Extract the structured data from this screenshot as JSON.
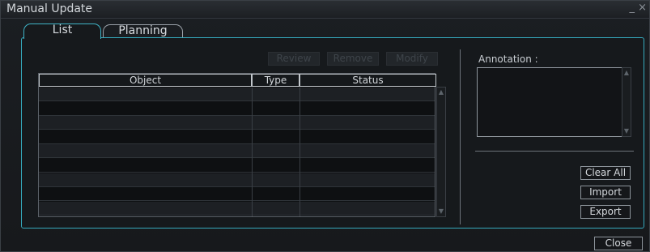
{
  "window": {
    "title": "Manual Update",
    "controls": "_ ×"
  },
  "tabs": [
    {
      "label": "List",
      "active": true
    },
    {
      "label": "Planning",
      "active": false
    }
  ],
  "toolbar": {
    "review_label": "Review",
    "remove_label": "Remove",
    "modify_label": "Modify"
  },
  "table": {
    "columns": [
      "Object",
      "Type",
      "Status"
    ],
    "rows": [
      {
        "object": "",
        "type": "",
        "status": ""
      },
      {
        "object": "",
        "type": "",
        "status": ""
      },
      {
        "object": "",
        "type": "",
        "status": ""
      },
      {
        "object": "",
        "type": "",
        "status": ""
      },
      {
        "object": "",
        "type": "",
        "status": ""
      },
      {
        "object": "",
        "type": "",
        "status": ""
      },
      {
        "object": "",
        "type": "",
        "status": ""
      },
      {
        "object": "",
        "type": "",
        "status": ""
      },
      {
        "object": "",
        "type": "",
        "status": ""
      }
    ]
  },
  "annotation": {
    "label": "Annotation :",
    "value": ""
  },
  "actions": {
    "clear_all_label": "Clear All",
    "import_label": "Import",
    "export_label": "Export",
    "close_label": "Close"
  },
  "colors": {
    "accent": "#35aabd",
    "background": "#16191c"
  }
}
